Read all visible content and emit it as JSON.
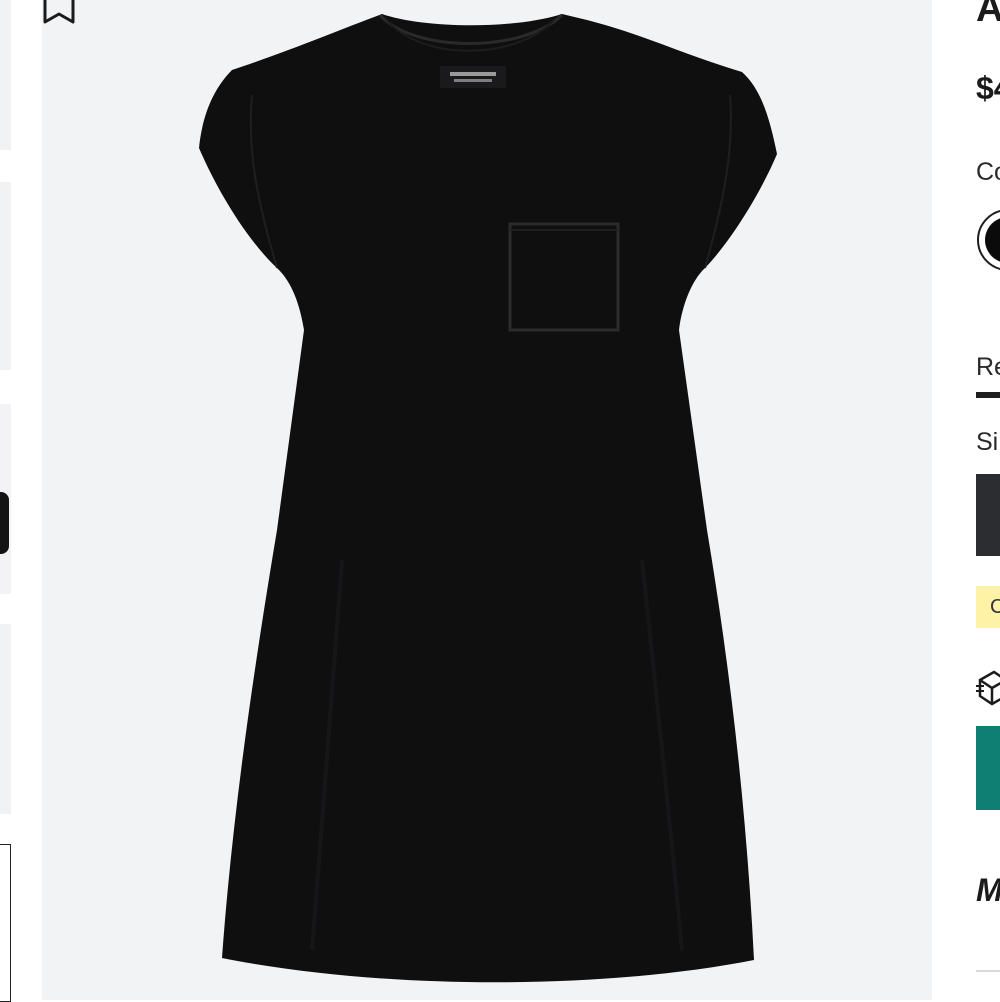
{
  "product": {
    "title": "A",
    "price": "$4",
    "color_label": "Co",
    "selected_color": "#0b0b0b"
  },
  "tabs": {
    "active_label": "Re"
  },
  "size": {
    "label": "Si"
  },
  "promo": {
    "text": "C"
  },
  "section": {
    "heading": "M"
  },
  "icons": {
    "bookmark": "bookmark-icon",
    "shipping": "shipping-box-icon"
  },
  "colors": {
    "image_background": "#f2f3f5",
    "garment": "#0f0f10",
    "primary_button": "#0e7f72",
    "size_button": "#2c2d30",
    "promo_background": "#fdf2a6"
  }
}
